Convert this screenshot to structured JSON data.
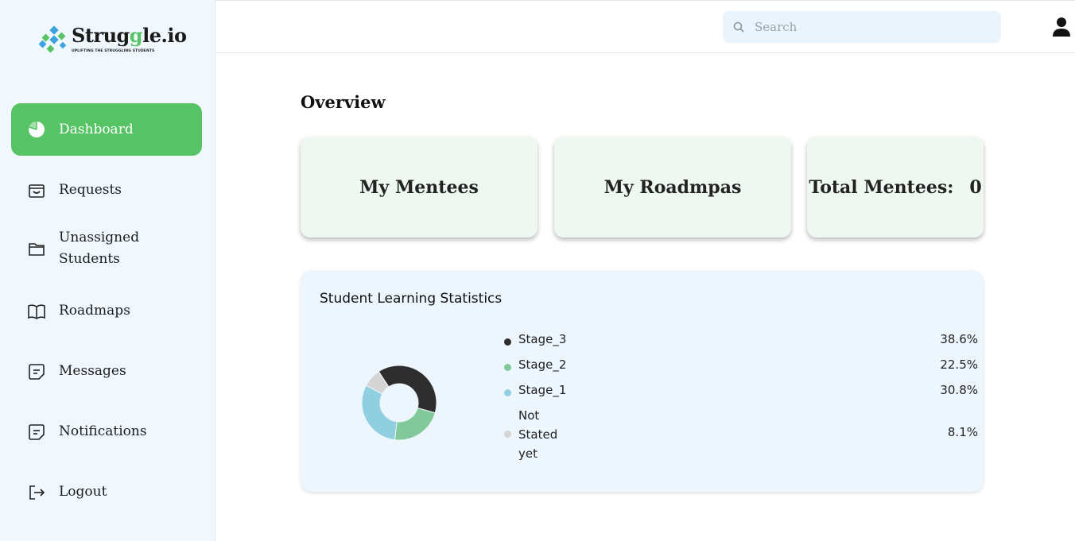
{
  "brand": {
    "name_pre": "Strug",
    "name_accent": "g",
    "name_post": "le.io",
    "tagline": "UPLIFTING THE STRUGGLING STUDENTS",
    "colors": {
      "accent": "#56c464",
      "logo_blue": "#3ba4e0"
    }
  },
  "sidebar": {
    "items": [
      {
        "label": "Dashboard",
        "icon": "pie-chart-icon",
        "active": true
      },
      {
        "label": "Requests",
        "icon": "inbox-icon"
      },
      {
        "label": "Unassigned Students",
        "icon": "folder-icon"
      },
      {
        "label": "Roadmaps",
        "icon": "book-icon"
      },
      {
        "label": "Messages",
        "icon": "message-icon"
      },
      {
        "label": "Notifications",
        "icon": "notification-icon"
      },
      {
        "label": "Logout",
        "icon": "logout-icon"
      }
    ]
  },
  "header": {
    "search_placeholder": "Search",
    "user_icon": "user-icon"
  },
  "main": {
    "title": "Overview",
    "cards": [
      {
        "label": "My Mentees"
      },
      {
        "label": "My Roadmpas"
      },
      {
        "label": "Total Mentees:",
        "value": "0"
      }
    ]
  },
  "stats": {
    "title": "Student Learning Statistics"
  },
  "chart_data": {
    "type": "pie",
    "variant": "donut",
    "title": "Student Learning Statistics",
    "categories": [
      "Stage_3",
      "Stage_2",
      "Stage_1",
      "Not Stated yet"
    ],
    "values": [
      38.6,
      22.5,
      30.8,
      8.1
    ],
    "labels": [
      "38.6%",
      "22.5%",
      "30.8%",
      "8.1%"
    ],
    "colors": [
      "#2e2e2e",
      "#82c99a",
      "#8fcfe0",
      "#d4d4d4"
    ],
    "legend": "right"
  }
}
